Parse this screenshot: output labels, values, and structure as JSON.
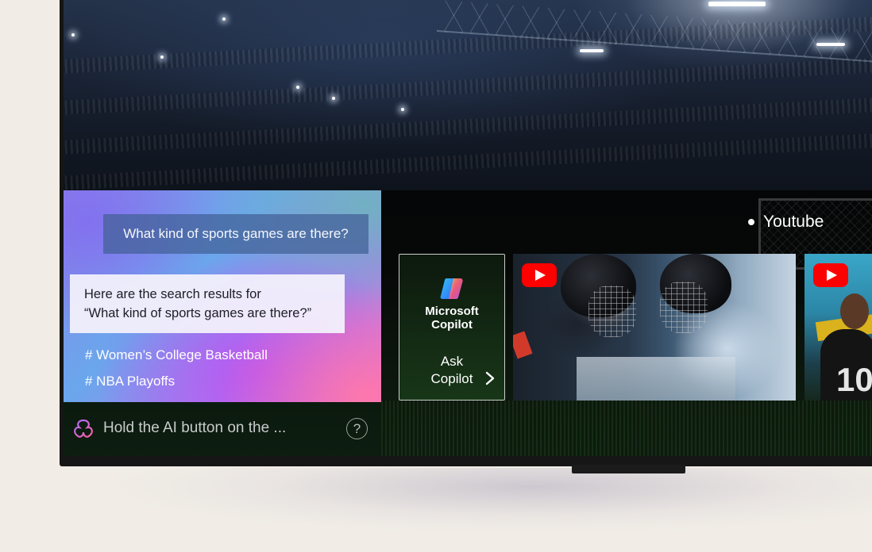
{
  "ai_panel": {
    "user_query": "What kind of sports games are there?",
    "answer_line1": "Here are the search results for",
    "answer_line2": "“What kind of sports games are there?”",
    "hashtags": [
      "# Women’s College Basketball",
      "# NBA Playoffs"
    ],
    "hint": "Hold the AI button on the ...",
    "help_symbol": "?"
  },
  "youtube_row": {
    "label": "Youtube",
    "copilot_card": {
      "brand_line1": "Microsoft",
      "brand_line2": "Copilot",
      "cta_line1": "Ask",
      "cta_line2": "Copilot"
    },
    "icons": {
      "youtube": "youtube-play-icon",
      "copilot": "copilot-logo-icon",
      "ai": "lg-ai-logo-icon",
      "chevron": "chevron-right-icon"
    }
  },
  "colors": {
    "background": "#f1ede6",
    "youtube_red": "#ff0000",
    "panel_gradient": [
      "#8c83e8",
      "#6aa7ec",
      "#a67ff0",
      "#ea79c8"
    ]
  }
}
